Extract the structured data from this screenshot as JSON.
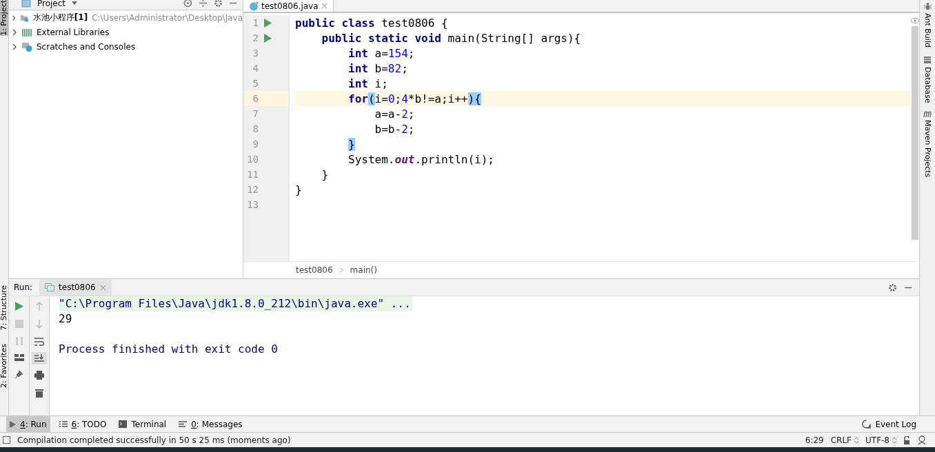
{
  "left_strip": [
    {
      "label": "1: Project",
      "selected": true
    },
    {
      "label": "7: Structure",
      "selected": false
    },
    {
      "label": "2: Favorites",
      "selected": false
    }
  ],
  "right_strip": [
    {
      "label": "Ant Build",
      "kind": "ant"
    },
    {
      "label": "Database",
      "kind": "database"
    },
    {
      "label": "Maven Projects",
      "kind": "maven"
    }
  ],
  "project": {
    "title": "Project",
    "items": [
      {
        "name": "水池小程序",
        "badge": "[1]",
        "path": "C:\\Users\\Administrator\\Desktop\\Java",
        "kind": "module"
      },
      {
        "name": "External Libraries",
        "kind": "libraries"
      },
      {
        "name": "Scratches and Consoles",
        "kind": "scratches"
      }
    ]
  },
  "editor": {
    "tabs": [
      {
        "label": "test0806.java",
        "selected": true
      }
    ],
    "lines": [
      {
        "number": "1",
        "run_marker": true,
        "current": false,
        "tokens": [
          {
            "text": "public class ",
            "kind": "keyword"
          },
          {
            "text": "test0806 {",
            "kind": "plain"
          }
        ]
      },
      {
        "number": "2",
        "run_marker": true,
        "current": false,
        "tokens": [
          {
            "text": "    public static void ",
            "kind": "keyword"
          },
          {
            "text": "main(String[] args){",
            "kind": "plain"
          }
        ]
      },
      {
        "number": "3",
        "run_marker": false,
        "current": false,
        "tokens": [
          {
            "text": "        int ",
            "kind": "keyword"
          },
          {
            "text": "a=",
            "kind": "plain"
          },
          {
            "text": "154",
            "kind": "number"
          },
          {
            "text": ";",
            "kind": "plain"
          }
        ]
      },
      {
        "number": "4",
        "run_marker": false,
        "current": false,
        "tokens": [
          {
            "text": "        int ",
            "kind": "keyword"
          },
          {
            "text": "b=",
            "kind": "plain"
          },
          {
            "text": "82",
            "kind": "number"
          },
          {
            "text": ";",
            "kind": "plain"
          }
        ]
      },
      {
        "number": "5",
        "run_marker": false,
        "current": false,
        "tokens": [
          {
            "text": "        int ",
            "kind": "keyword"
          },
          {
            "text": "i;",
            "kind": "plain"
          }
        ]
      },
      {
        "number": "6",
        "run_marker": false,
        "current": true,
        "tokens": [
          {
            "text": "        for",
            "kind": "keyword"
          },
          {
            "text": "(",
            "kind": "match"
          },
          {
            "text": "i=",
            "kind": "plain"
          },
          {
            "text": "0",
            "kind": "number"
          },
          {
            "text": ";",
            "kind": "plain"
          },
          {
            "text": "4",
            "kind": "number"
          },
          {
            "text": "*b!=a;i++",
            "kind": "plain"
          },
          {
            "text": ")",
            "kind": "match"
          },
          {
            "text": "{",
            "kind": "match"
          }
        ]
      },
      {
        "number": "7",
        "run_marker": false,
        "current": false,
        "tokens": [
          {
            "text": "            a=a-",
            "kind": "plain"
          },
          {
            "text": "2",
            "kind": "number"
          },
          {
            "text": ";",
            "kind": "plain"
          }
        ]
      },
      {
        "number": "8",
        "run_marker": false,
        "current": false,
        "tokens": [
          {
            "text": "            b=b-",
            "kind": "plain"
          },
          {
            "text": "2",
            "kind": "number"
          },
          {
            "text": ";",
            "kind": "plain"
          }
        ]
      },
      {
        "number": "9",
        "run_marker": false,
        "current": false,
        "tokens": [
          {
            "text": "        }",
            "kind": "match"
          }
        ]
      },
      {
        "number": "10",
        "run_marker": false,
        "current": false,
        "tokens": [
          {
            "text": "        System.",
            "kind": "plain"
          },
          {
            "text": "out",
            "kind": "field"
          },
          {
            "text": ".println(i);",
            "kind": "plain"
          }
        ]
      },
      {
        "number": "11",
        "run_marker": false,
        "current": false,
        "tokens": [
          {
            "text": "    }",
            "kind": "plain"
          }
        ]
      },
      {
        "number": "12",
        "run_marker": false,
        "current": false,
        "tokens": [
          {
            "text": "}",
            "kind": "plain"
          }
        ]
      },
      {
        "number": "13",
        "run_marker": false,
        "current": false
      }
    ],
    "breadcrumbs": [
      "test0806",
      "main()"
    ]
  },
  "run": {
    "label": "Run:",
    "tabs": [
      {
        "label": "test0806",
        "selected": true
      }
    ],
    "output": [
      {
        "text": "\"C:\\Program Files\\Java\\jdk1.8.0_212\\bin\\java.exe\" ...",
        "kind": "command"
      },
      {
        "text": "29",
        "kind": "stdout"
      },
      {
        "text": "Process finished with exit code 0",
        "kind": "system"
      }
    ]
  },
  "tool_windows": [
    {
      "key": "4",
      "label": ": Run",
      "kind": "run",
      "selected": true
    },
    {
      "key": "6",
      "label": ": TODO",
      "kind": "todo",
      "selected": false
    },
    {
      "label": "Terminal",
      "kind": "terminal",
      "selected": false
    },
    {
      "key": "0",
      "label": ": Messages",
      "kind": "messages",
      "selected": false
    }
  ],
  "event_log": "Event Log",
  "status_bar": {
    "message": "Compilation completed successfully in 50 s 25 ms (moments ago)",
    "position": "6:29",
    "line_separator": "CRLF",
    "encoding": "UTF-8"
  }
}
